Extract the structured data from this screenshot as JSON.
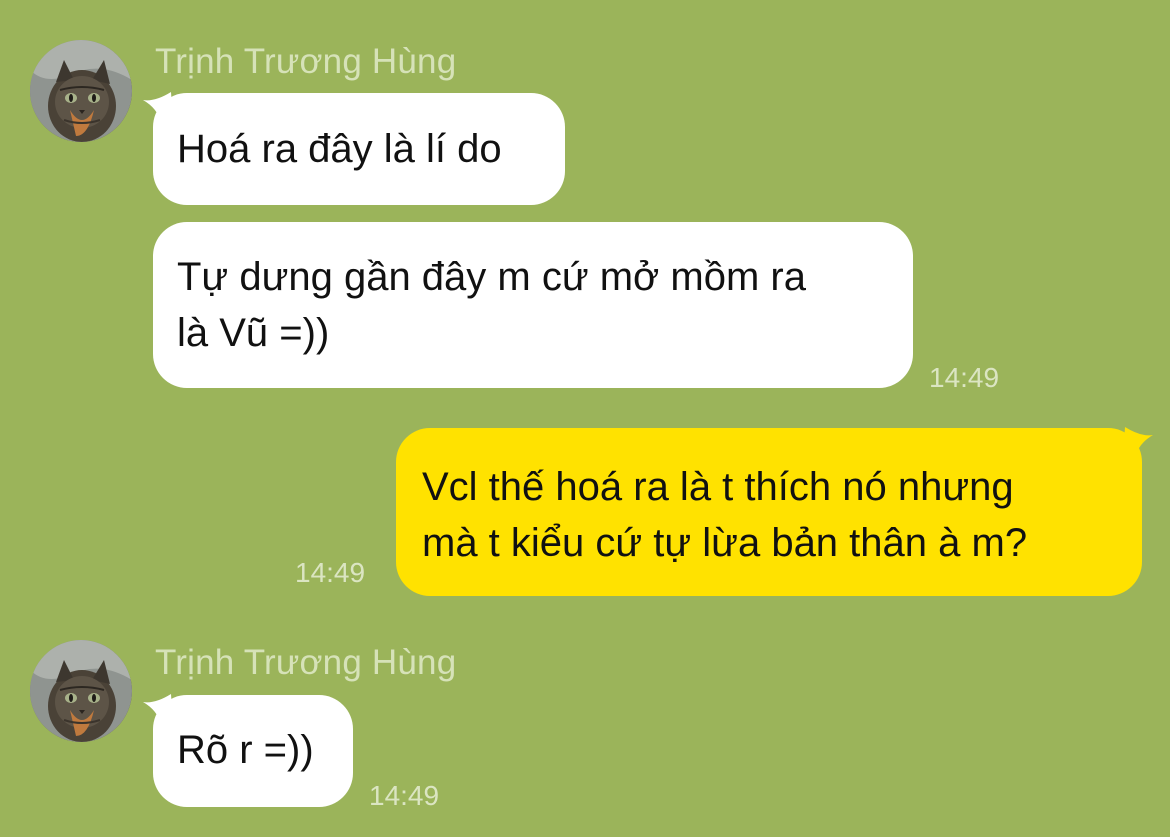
{
  "chat": {
    "background_color": "#9bb45a",
    "incoming_bubble_color": "#ffffff",
    "outgoing_bubble_color": "#ffe200",
    "groups": [
      {
        "direction": "incoming",
        "sender": "Trịnh Trương Hùng",
        "avatar_icon": "cat-avatar-icon",
        "messages": [
          "Hoá ra đây là lí do",
          "Tự dưng gần đây m cứ mở mồm ra\nlà Vũ =))"
        ],
        "time": "14:49"
      },
      {
        "direction": "outgoing",
        "messages": [
          "Vcl thế hoá ra là t thích nó nhưng\nmà t kiểu cứ tự lừa bản thân à m?"
        ],
        "time": "14:49"
      },
      {
        "direction": "incoming",
        "sender": "Trịnh Trương Hùng",
        "avatar_icon": "cat-avatar-icon",
        "messages": [
          "Rõ r =))"
        ],
        "time": "14:49"
      }
    ]
  }
}
